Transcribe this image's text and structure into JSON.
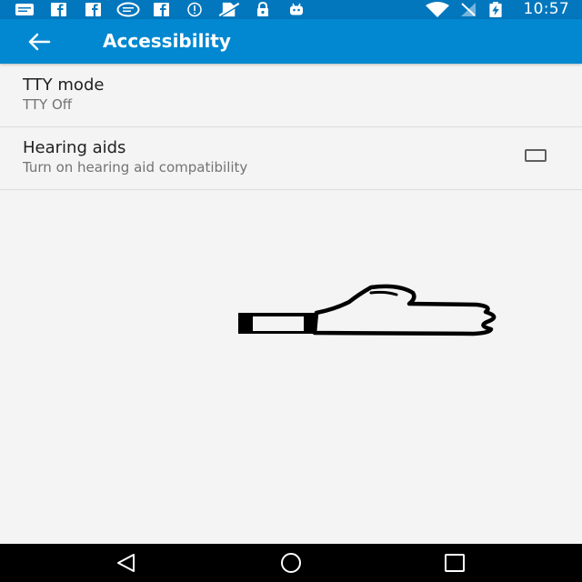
{
  "status_bar": {
    "time": "10:57",
    "left_icons": [
      "notification-icon",
      "facebook-icon",
      "facebook-icon",
      "chat-icon",
      "facebook-icon",
      "info-icon",
      "no-sim-icon",
      "lock-icon",
      "android-icon"
    ],
    "right_icons": [
      "wifi-icon",
      "signal-icon",
      "battery-charging-icon"
    ]
  },
  "app_bar": {
    "title": "Accessibility",
    "back_icon": "arrow-back-icon",
    "color": "#0288d1"
  },
  "preferences": [
    {
      "title": "TTY mode",
      "summary": "TTY Off"
    },
    {
      "title": "Hearing aids",
      "summary": "Turn on hearing aid compatibility",
      "checked": false
    }
  ],
  "overlay": {
    "icon": "thumbs-up-icon"
  },
  "nav_bar": {
    "buttons": [
      "back-triangle-icon",
      "home-circle-icon",
      "recents-square-icon"
    ]
  },
  "colors": {
    "status_bar": "#0277bd",
    "app_bar": "#0288d1",
    "background": "#f4f4f4"
  }
}
